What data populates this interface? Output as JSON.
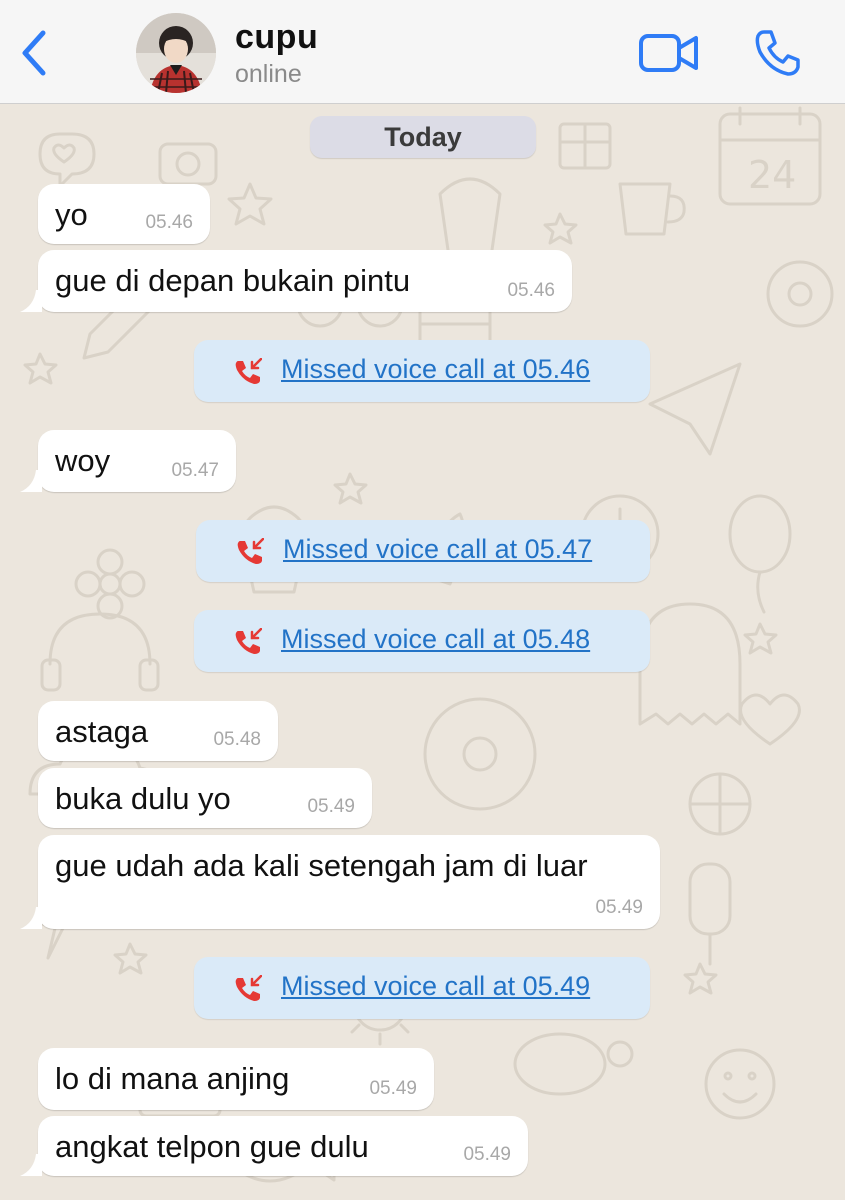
{
  "header": {
    "back_icon": "chevron-left-icon",
    "contact_name": "cupu",
    "contact_status": "online",
    "video_icon": "video-camera-icon",
    "call_icon": "phone-icon",
    "accent_color": "#2f7cf6"
  },
  "chat": {
    "date_label": "Today",
    "items": [
      {
        "kind": "message",
        "text": "yo",
        "time": "05.46"
      },
      {
        "kind": "message",
        "text": "gue di depan bukain pintu",
        "time": "05.46"
      },
      {
        "kind": "missed_call",
        "label": "Missed voice call at 05.46"
      },
      {
        "kind": "message",
        "text": "woy",
        "time": "05.47"
      },
      {
        "kind": "missed_call",
        "label": "Missed voice call at 05.47"
      },
      {
        "kind": "missed_call",
        "label": "Missed voice call at 05.48"
      },
      {
        "kind": "message",
        "text": "astaga",
        "time": "05.48"
      },
      {
        "kind": "message",
        "text": "buka dulu yo",
        "time": "05.49"
      },
      {
        "kind": "message",
        "text": "gue udah ada kali setengah jam di luar",
        "time": "05.49"
      },
      {
        "kind": "missed_call",
        "label": "Missed voice call at 05.49"
      },
      {
        "kind": "message",
        "text": "lo di mana anjing",
        "time": "05.49"
      },
      {
        "kind": "message",
        "text": "angkat telpon gue dulu",
        "time": "05.49"
      }
    ],
    "colors": {
      "bubble": "#ffffff",
      "missed_call_bg": "#daeaf8",
      "missed_call_text": "#2273c7",
      "missed_call_icon": "#e53935",
      "wallpaper": "#ece6dd"
    }
  }
}
